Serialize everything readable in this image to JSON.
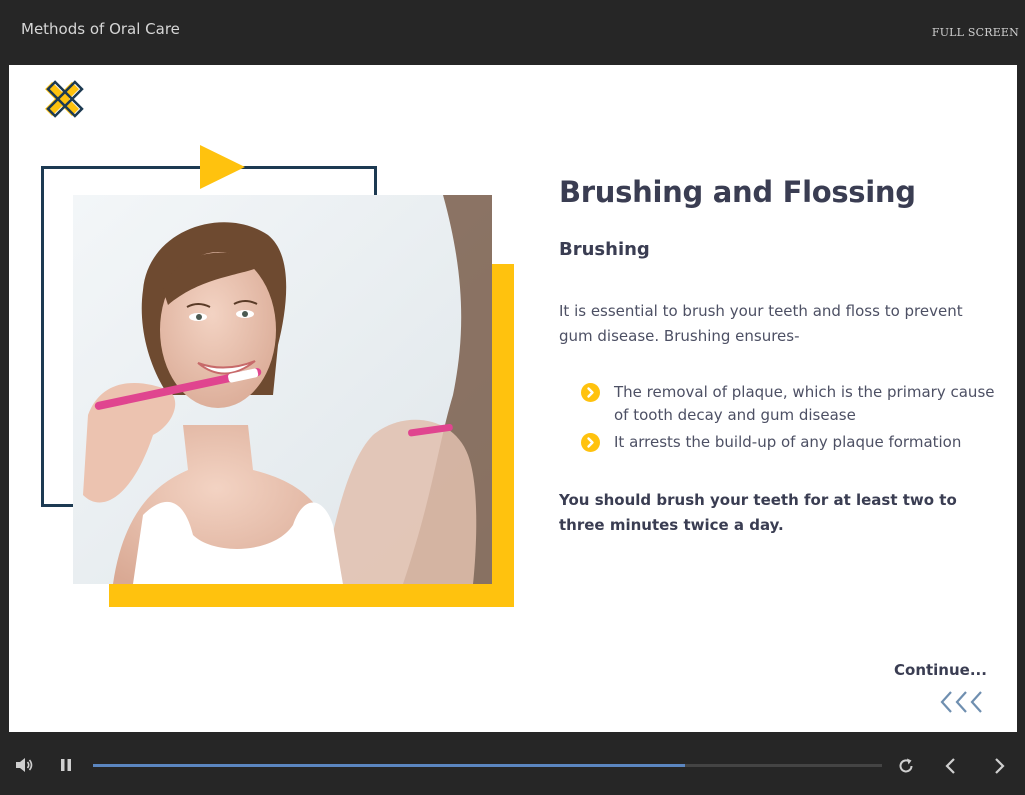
{
  "header": {
    "course_title": "Methods of Oral Care",
    "fullscreen_label": "FULL SCREEN"
  },
  "slide": {
    "title": "Brushing and Flossing",
    "subtitle": "Brushing",
    "intro": "It is essential to brush your teeth and floss to prevent gum disease. Brushing ensures-",
    "bullets": [
      "The removal of plaque, which is the primary cause of tooth decay and gum disease",
      "It arrests the build-up of any plaque formation"
    ],
    "emphasis": "You should brush your teeth for at least two to three minutes twice a day.",
    "continue_label": "Continue...",
    "photo_subject": "woman-brushing-teeth-in-mirror"
  },
  "player": {
    "progress_percent": 75,
    "icons": [
      "volume-icon",
      "pause-icon",
      "replay-icon",
      "prev-icon",
      "next-icon"
    ]
  },
  "colors": {
    "accent_yellow": "#ffc20e",
    "navy": "#1d3a52",
    "text_dark": "#3a3d52",
    "progress": "#5b86c0",
    "chrome": "#262626"
  }
}
